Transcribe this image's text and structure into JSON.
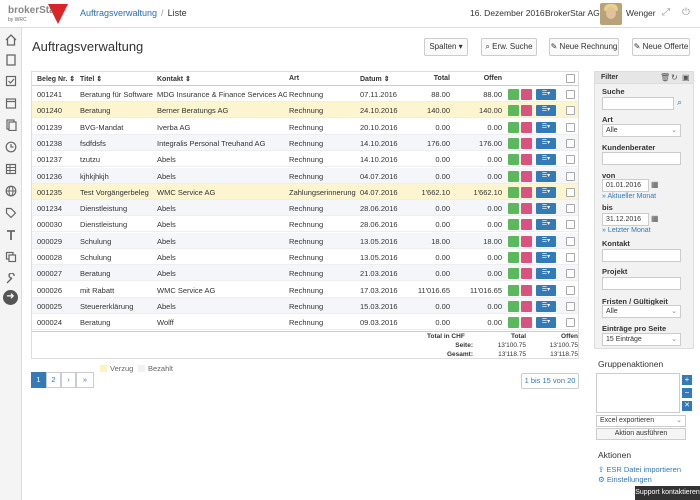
{
  "app": {
    "logo_text": "brokerStar",
    "logo_sub": "by WRC"
  },
  "breadcrumb": {
    "parent": "Auftragsverwaltung",
    "sep": "/",
    "current": "Liste"
  },
  "header": {
    "date": "16. Dezember 2016",
    "company": "BrokerStar AG",
    "user": "Wenger"
  },
  "page": {
    "title": "Auftragsverwaltung"
  },
  "toolbar": {
    "columns": "Spalten ▾",
    "search": "Erw. Suche",
    "new_invoice": "Neue Rechnung",
    "new_offer": "Neue Offerte"
  },
  "table": {
    "headers": [
      "Beleg Nr. ⇕",
      "Titel ⇕",
      "Kontakt ⇕",
      "Art",
      "Datum ⇕",
      "Total",
      "Offen"
    ],
    "rows": [
      {
        "nr": "001241",
        "titel": "Beratung für Software",
        "kontakt": "MDG Insurance & Finance Services AG",
        "art": "Rechnung",
        "datum": "07.11.2016",
        "total": "88.00",
        "offen": "88.00"
      },
      {
        "nr": "001240",
        "titel": "Beratung",
        "kontakt": "Berner Beratungs AG",
        "art": "Rechnung",
        "datum": "24.10.2016",
        "total": "140.00",
        "offen": "140.00"
      },
      {
        "nr": "001239",
        "titel": "BVG-Mandat",
        "kontakt": "Iverba AG",
        "art": "Rechnung",
        "datum": "20.10.2016",
        "total": "0.00",
        "offen": "0.00"
      },
      {
        "nr": "001238",
        "titel": "fsdfdsfs",
        "kontakt": "Integralis Personal Treuhand AG",
        "art": "Rechnung",
        "datum": "14.10.2016",
        "total": "176.00",
        "offen": "176.00"
      },
      {
        "nr": "001237",
        "titel": "tzutzu",
        "kontakt": "Abels",
        "art": "Rechnung",
        "datum": "14.10.2016",
        "total": "0.00",
        "offen": "0.00"
      },
      {
        "nr": "001236",
        "titel": "kjhkjhkjh",
        "kontakt": "Abels",
        "art": "Rechnung",
        "datum": "04.07.2016",
        "total": "0.00",
        "offen": "0.00"
      },
      {
        "nr": "001235",
        "titel": "Test Vorgängerbeleg",
        "kontakt": "WMC Service AG",
        "art": "Zahlungserinnerung",
        "datum": "04.07.2016",
        "total": "1'662.10",
        "offen": "1'662.10"
      },
      {
        "nr": "001234",
        "titel": "Dienstleistung",
        "kontakt": "Abels",
        "art": "Rechnung",
        "datum": "28.06.2016",
        "total": "0.00",
        "offen": "0.00"
      },
      {
        "nr": "000030",
        "titel": "Dienstleistung",
        "kontakt": "Abels",
        "art": "Rechnung",
        "datum": "28.06.2016",
        "total": "0.00",
        "offen": "0.00"
      },
      {
        "nr": "000029",
        "titel": "Schulung",
        "kontakt": "Abels",
        "art": "Rechnung",
        "datum": "13.05.2016",
        "total": "18.00",
        "offen": "18.00"
      },
      {
        "nr": "000028",
        "titel": "Schulung",
        "kontakt": "Abels",
        "art": "Rechnung",
        "datum": "13.05.2016",
        "total": "0.00",
        "offen": "0.00"
      },
      {
        "nr": "000027",
        "titel": "Beratung",
        "kontakt": "Abels",
        "art": "Rechnung",
        "datum": "21.03.2016",
        "total": "0.00",
        "offen": "0.00"
      },
      {
        "nr": "000026",
        "titel": "mit Rabatt",
        "kontakt": "WMC Service AG",
        "art": "Rechnung",
        "datum": "17.03.2016",
        "total": "11'016.65",
        "offen": "11'016.65"
      },
      {
        "nr": "000025",
        "titel": "Steuererklärung",
        "kontakt": "Abels",
        "art": "Rechnung",
        "datum": "15.03.2016",
        "total": "0.00",
        "offen": "0.00"
      },
      {
        "nr": "000024",
        "titel": "Beratung",
        "kontakt": "Wolff",
        "art": "Rechnung",
        "datum": "09.03.2016",
        "total": "0.00",
        "offen": "0.00"
      }
    ],
    "highlight": [
      false,
      true,
      false,
      false,
      false,
      false,
      true,
      false,
      false,
      false,
      false,
      false,
      false,
      false,
      false
    ],
    "totals": {
      "label_head": "Total in CHF",
      "col_total": "Total",
      "col_offen": "Offen",
      "label_seite": "Seite:",
      "seite_total": "13'100.75",
      "seite_offen": "13'100.75",
      "label_gesamt": "Gesamt:",
      "gesamt_total": "13'118.75",
      "gesamt_offen": "13'118.75"
    }
  },
  "pager": {
    "p1": "1",
    "p2": "2",
    "next": "›",
    "last": "»",
    "range": "1 bis 15 von 20"
  },
  "legend": {
    "overdue": "Verzug",
    "paid": "Bezahlt",
    "overdue_color": "#fbf3c4",
    "paid_color": "#f1f1f1"
  },
  "filter": {
    "title": "Filter",
    "search_label": "Suche",
    "search_value": "",
    "art_label": "Art",
    "art_value": "Alle",
    "berater_label": "Kundenberater",
    "berater_value": "",
    "von_label": "von",
    "von_value": "01.01.2016",
    "von_link": "» Aktueller Monat",
    "bis_label": "bis",
    "bis_value": "31.12.2016",
    "bis_link": "» Letzter Monat",
    "kontakt_label": "Kontakt",
    "kontakt_value": "",
    "projekt_label": "Projekt",
    "projekt_value": "",
    "fristen_label": "Fristen / Gültigkeit",
    "fristen_value": "Alle",
    "eintraege_label": "Einträge pro Seite",
    "eintraege_value": "15 Einträge"
  },
  "gruppe": {
    "title": "Gruppenaktionen",
    "select": "Excel exportieren",
    "button": "Aktion ausführen"
  },
  "aktionen": {
    "title": "Aktionen",
    "import": "ESR Datei importieren",
    "settings": "Einstellungen"
  },
  "support": {
    "label": "Support kontaktieren"
  },
  "colors": {
    "accent": "#337ab7",
    "green": "#5cb85c",
    "pink": "#d9537e",
    "brand_red": "#d9252a"
  }
}
